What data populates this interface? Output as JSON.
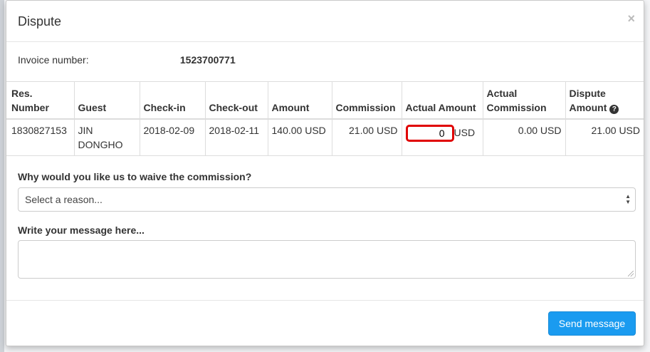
{
  "modal": {
    "title": "Dispute",
    "close_symbol": "×"
  },
  "invoice": {
    "label": "Invoice number:",
    "value": "1523700771"
  },
  "table": {
    "headers": {
      "res_number": "Res. Number",
      "guest": "Guest",
      "check_in": "Check-in",
      "check_out": "Check-out",
      "amount": "Amount",
      "commission": "Commission",
      "actual_amount": "Actual Amount",
      "actual_commission": "Actual Commission",
      "dispute_amount": "Dispute Amount",
      "help_icon": "?"
    },
    "row": {
      "res_number": "1830827153",
      "guest": "JIN DONGHO",
      "check_in": "2018-02-09",
      "check_out": "2018-02-11",
      "amount": "140.00 USD",
      "commission": "21.00 USD",
      "actual_amount_value": "0",
      "actual_amount_currency": "USD",
      "actual_commission": "0.00 USD",
      "dispute_amount": "21.00 USD"
    }
  },
  "form": {
    "reason_question": "Why would you like us to waive the commission?",
    "reason_placeholder": "Select a reason...",
    "message_label": "Write your message here...",
    "message_value": ""
  },
  "footer": {
    "send_label": "Send message"
  },
  "colors": {
    "primary_button": "#1a9bf0",
    "highlight_border": "#e00000"
  },
  "icons": {
    "close": "close-icon",
    "help": "question-circle-icon",
    "select_arrows": "select-arrows-icon"
  }
}
